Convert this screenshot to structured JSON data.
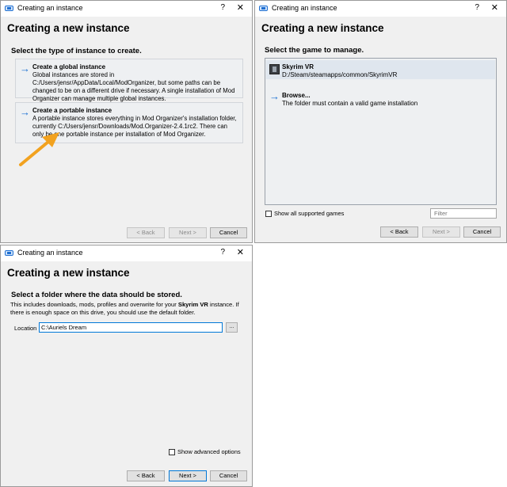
{
  "window_title": "Creating an instance",
  "help_label": "?",
  "close_label": "✕",
  "heading": "Creating a new instance",
  "back_label": "< Back",
  "next_label": "Next >",
  "cancel_label": "Cancel",
  "type_page": {
    "subheading": "Select the type of instance to create.",
    "options": [
      {
        "title": "Create a global instance",
        "description": "Global instances are stored in C:/Users/jensr/AppData/Local/ModOrganizer, but some paths can be changed to be on a different drive if necessary. A single installation of Mod Organizer can manage multiple global instances."
      },
      {
        "title": "Create a portable instance",
        "description": "A portable instance stores everything in Mod Organizer's installation folder, currently C:/Users/jensr/Downloads/Mod.Organizer-2.4.1rc2. There can only be one portable instance per installation of Mod Organizer."
      }
    ]
  },
  "game_page": {
    "subheading": "Select the game to manage.",
    "games": [
      {
        "name": "Skyrim VR",
        "path": "D:/Steam/steamapps/common/SkyrimVR"
      },
      {
        "name": "Browse...",
        "path": "The folder must contain a valid game installation"
      }
    ],
    "show_all_label": "Show all supported games",
    "show_all_checked": false,
    "filter_placeholder": "Filter"
  },
  "folder_page": {
    "subheading": "Select a folder where the data should be stored.",
    "info_prefix": "This includes downloads, mods, profiles and overwrite for your ",
    "info_game": "Skyrim VR",
    "info_suffix": " instance. If there is enough space on this drive, you should use the default folder.",
    "location_label": "Location",
    "location_value": "C:\\Auriels Dream",
    "browse_label": "...",
    "advanced_label": "Show advanced options",
    "advanced_checked": false
  },
  "colors": {
    "accent": "#1a6fd1",
    "annotation_arrow": "#f2a21f",
    "dialog_bg": "#f0f0f0"
  }
}
